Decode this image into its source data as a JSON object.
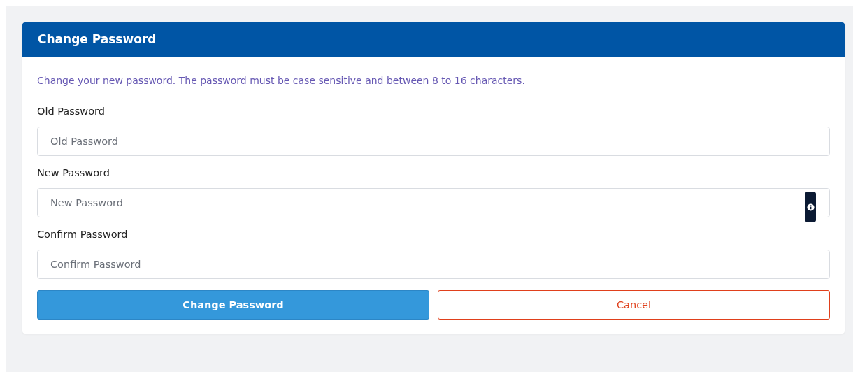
{
  "card": {
    "title": "Change Password",
    "description": "Change your new password. The password must be case sensitive and between 8 to 16 characters.",
    "fields": [
      {
        "label": "Old Password",
        "placeholder": "Old Password",
        "info": false
      },
      {
        "label": "New Password",
        "placeholder": "New Password",
        "info": true
      },
      {
        "label": "Confirm Password",
        "placeholder": "Confirm Password",
        "info": false
      }
    ],
    "buttons": [
      {
        "label": "Change Password",
        "kind": "primary"
      },
      {
        "label": "Cancel",
        "kind": "cancel"
      }
    ]
  }
}
